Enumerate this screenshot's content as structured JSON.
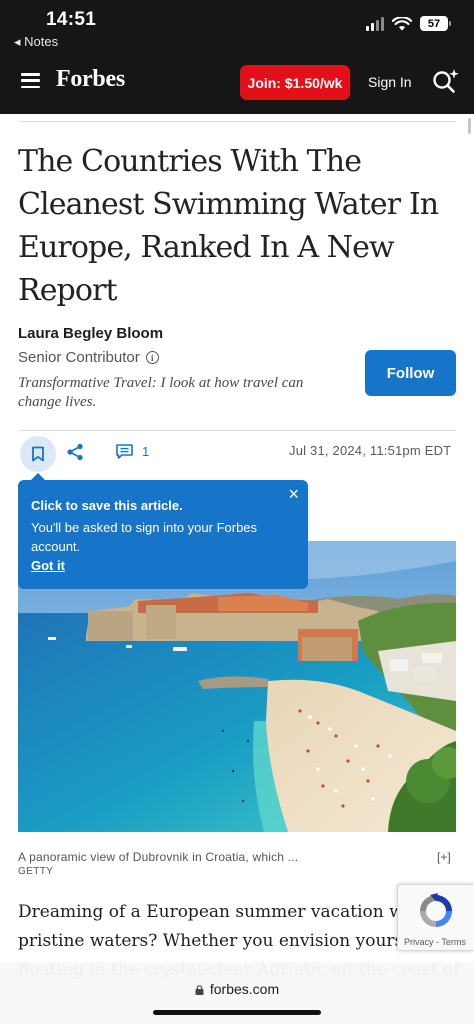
{
  "status_bar": {
    "time": "14:51",
    "back_label": "◂ Notes",
    "battery": "57"
  },
  "nav": {
    "logo": "Forbes",
    "join_label": "Join: $1.50/wk",
    "signin_label": "Sign In",
    "icons": [
      "menu-icon",
      "search-sparkle-icon"
    ]
  },
  "article": {
    "headline": "The Countries With The Cleanest Swimming Water In Europe, Ranked In A New Report",
    "author": "Laura Begley Bloom",
    "role": "Senior Contributor",
    "bio": "Transformative Travel: I look at how travel can change lives.",
    "follow_label": "Follow",
    "comment_count": "1",
    "date": "Jul 31, 2024, 11:51pm EDT",
    "caption": "A panoramic view of Dubrovnik in Croatia, which ...",
    "expand_label": "[+]",
    "credit": "GETTY",
    "body_line_1": "Dreaming of a European summer vacation with",
    "body_line_2": "pristine waters? Whether you envision yourself",
    "body_line_3": "floating in the crystal-clear Adriatic off the coast of"
  },
  "tooltip": {
    "title": "Click to save this article.",
    "body": "You'll be asked to sign into your Forbes account.",
    "link": "Got it",
    "close": "×"
  },
  "recaptcha": {
    "links": "Privacy - Terms"
  },
  "browser": {
    "url": "forbes.com"
  },
  "colors": {
    "nav_bg": "#161616",
    "join_red": "#e3101a",
    "accent_blue": "#1675c8"
  }
}
